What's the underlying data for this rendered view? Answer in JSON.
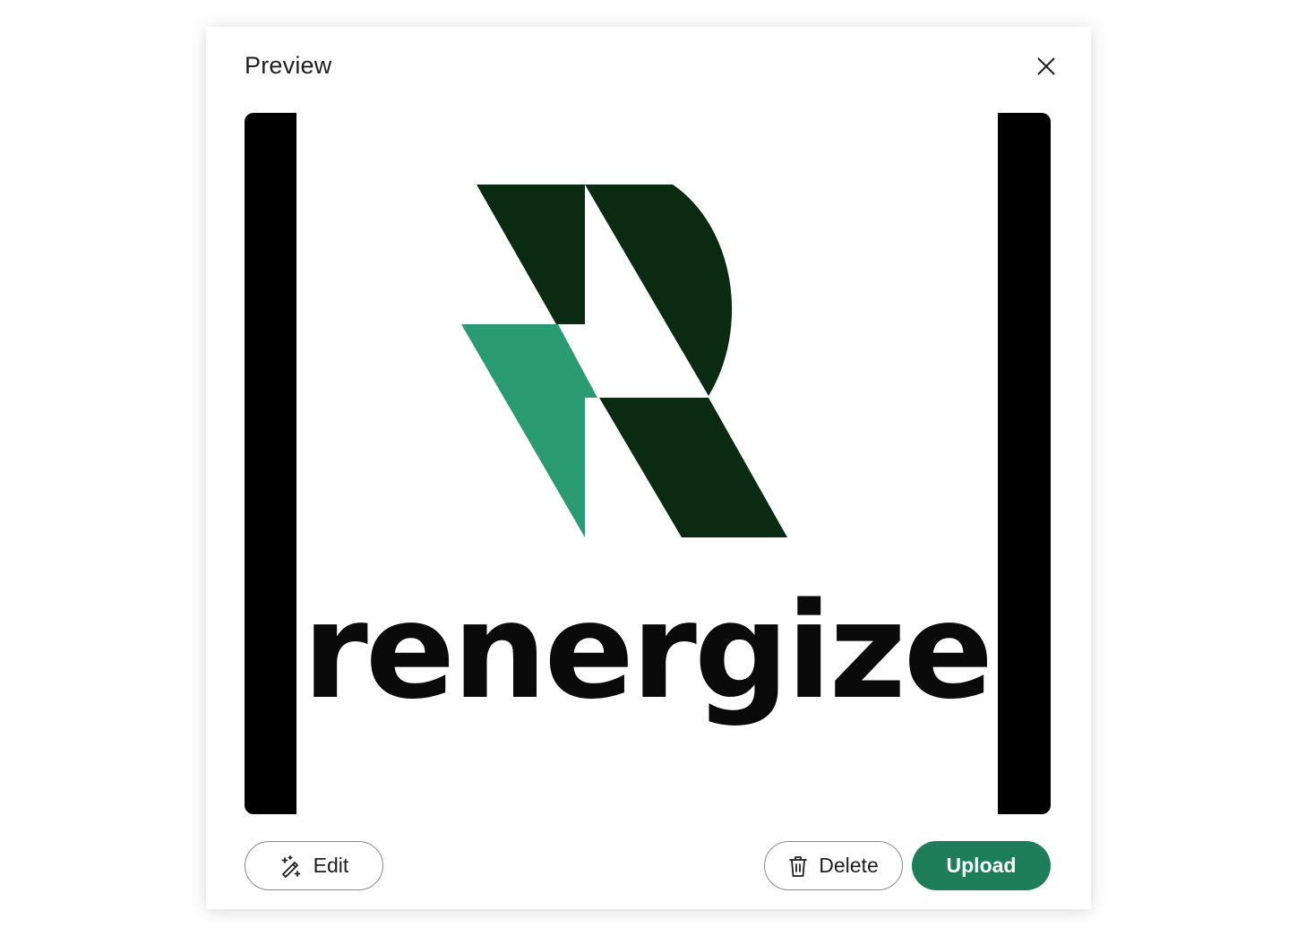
{
  "dialog": {
    "title": "Preview",
    "close_icon": "close-icon"
  },
  "preview": {
    "logo_text": "renergize",
    "brand_dark": "#0a2a12",
    "brand_accent": "#2a9a72"
  },
  "actions": {
    "edit_label": "Edit",
    "edit_icon": "magic-wand-icon",
    "delete_label": "Delete",
    "delete_icon": "trash-icon",
    "upload_label": "Upload",
    "upload_color": "#1e7e5c"
  }
}
